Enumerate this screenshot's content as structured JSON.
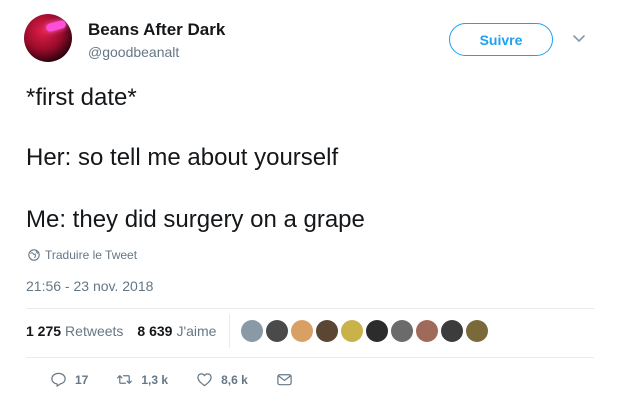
{
  "author": {
    "display_name": "Beans After Dark",
    "handle": "@goodbeanalt"
  },
  "follow_button": {
    "label": "Suivre"
  },
  "tweet": {
    "lines": [
      "*first date*",
      "Her: so tell me about yourself",
      "Me: they did surgery on a grape"
    ],
    "translate_label": "Traduire le Tweet",
    "timestamp": "21:56 - 23 nov. 2018"
  },
  "stats": {
    "retweets_count": "1 275",
    "retweets_label": "Retweets",
    "likes_count": "8 639",
    "likes_label": "J'aime"
  },
  "likers": {
    "colors": [
      "#8a99a6",
      "#4a4a4a",
      "#d9a066",
      "#5a4632",
      "#c9b24a",
      "#2c2c2c",
      "#6b6b6b",
      "#a06a5a",
      "#3c3c3c",
      "#7a6a3a"
    ]
  },
  "actions": {
    "reply_count": "17",
    "retweet_count": "1,3 k",
    "like_count": "8,6 k"
  },
  "colors": {
    "accent": "#1da1f2",
    "text": "#14171a",
    "muted": "#657786"
  }
}
